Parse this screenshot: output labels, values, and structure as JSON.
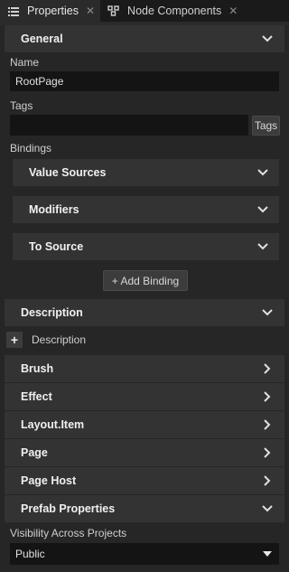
{
  "tabs": [
    {
      "label": "Properties",
      "icon": "list-icon",
      "active": true
    },
    {
      "label": "Node Components",
      "icon": "components-icon",
      "active": false
    }
  ],
  "general": {
    "header": "General",
    "name_label": "Name",
    "name_value": "RootPage",
    "tags_label": "Tags",
    "tags_value": "",
    "tags_button": "Tags",
    "bindings_label": "Bindings",
    "bindings": {
      "value_sources": "Value Sources",
      "modifiers": "Modifiers",
      "to_source": "To Source"
    },
    "add_binding": "+ Add Binding"
  },
  "description": {
    "header": "Description",
    "add_label": "Description"
  },
  "sections": {
    "brush": "Brush",
    "effect": "Effect",
    "layout_item": "Layout.Item",
    "page": "Page",
    "page_host": "Page Host",
    "prefab": "Prefab Properties"
  },
  "visibility": {
    "label": "Visibility Across Projects",
    "value": "Public"
  },
  "colors": {
    "panel_bg": "#262626",
    "header_bg": "#333333",
    "field_bg": "#141414"
  }
}
